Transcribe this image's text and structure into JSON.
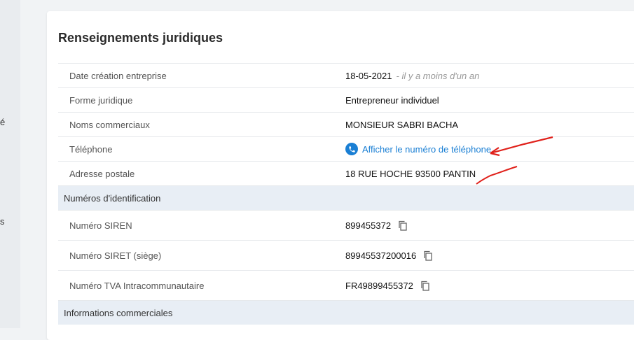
{
  "sidebar": {
    "fragments": [
      "é",
      "s"
    ]
  },
  "card": {
    "title": "Renseignements juridiques"
  },
  "rows": [
    {
      "label": "Date création entreprise",
      "value": "18-05-2021",
      "note": "- il y a moins d'un an"
    },
    {
      "label": "Forme juridique",
      "value": "Entrepreneur individuel"
    },
    {
      "label": "Noms commerciaux",
      "value": "MONSIEUR SABRI BACHA"
    },
    {
      "label": "Téléphone",
      "link": "Afficher le numéro de téléphone"
    },
    {
      "label": "Adresse postale",
      "value": "18 RUE HOCHE 93500 PANTIN"
    }
  ],
  "sections": {
    "ids": "Numéros d'identification",
    "commercial": "Informations commerciales"
  },
  "id_rows": [
    {
      "label": "Numéro SIREN",
      "value": "899455372"
    },
    {
      "label": "Numéro SIRET (siège)",
      "value": "89945537200016"
    },
    {
      "label": "Numéro TVA Intracommunautaire",
      "value": "FR49899455372"
    }
  ],
  "icons": {
    "phone": "phone-icon",
    "copy": "copy-icon"
  },
  "colors": {
    "link": "#1a7fd4",
    "section_bg": "#e8eef5",
    "annotation": "#e0201a"
  }
}
